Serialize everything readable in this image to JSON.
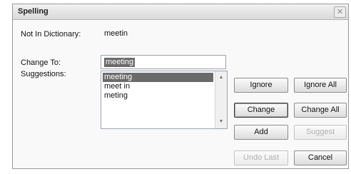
{
  "window": {
    "title": "Spelling",
    "close_glyph": "✕"
  },
  "not_in_dictionary": {
    "label": "Not In Dictionary:",
    "value": "meetin"
  },
  "change_to": {
    "label": "Change To:",
    "value": "meeting"
  },
  "suggestions": {
    "label": "Suggestions:",
    "items": [
      "meeting",
      "meet in",
      "meting"
    ],
    "selected_index": 0
  },
  "buttons": {
    "ignore": "Ignore",
    "ignore_all": "Ignore All",
    "change": "Change",
    "change_all": "Change All",
    "add": "Add",
    "suggest": "Suggest",
    "undo_last": "Undo Last",
    "cancel": "Cancel"
  },
  "colors": {
    "selection": "#6b6b6b",
    "disabled_text": "#b0b0b0"
  },
  "icons": {
    "close": "close-icon",
    "scroll_up": "scroll-up-icon",
    "scroll_down": "scroll-down-icon"
  }
}
